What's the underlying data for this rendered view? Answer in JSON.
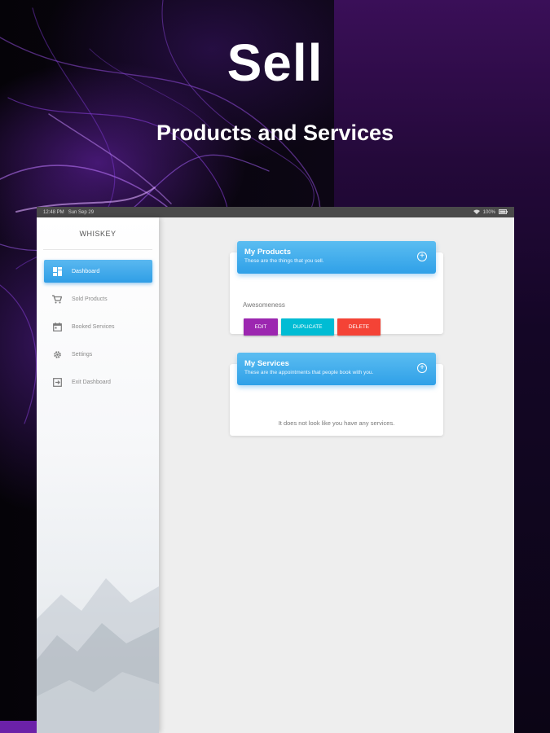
{
  "hero": {
    "title": "Sell",
    "subtitle": "Products and Services"
  },
  "status_bar": {
    "time": "12:48 PM",
    "date": "Sun Sep 29",
    "battery": "100%"
  },
  "sidebar": {
    "brand": "WHISKEY",
    "items": [
      {
        "label": "Dashboard",
        "icon": "dashboard-icon",
        "active": true
      },
      {
        "label": "Sold Products",
        "icon": "cart-icon",
        "active": false
      },
      {
        "label": "Booked Services",
        "icon": "calendar-icon",
        "active": false
      },
      {
        "label": "Settings",
        "icon": "gear-icon",
        "active": false
      },
      {
        "label": "Exit Dashboard",
        "icon": "exit-icon",
        "active": false
      }
    ]
  },
  "products_card": {
    "title": "My Products",
    "description": "These are the things that you sell.",
    "add_icon": "add-circle-icon",
    "items": [
      {
        "name": "Awesomeness",
        "actions": {
          "edit": "EDIT",
          "duplicate": "DUPLICATE",
          "delete": "DELETE"
        }
      }
    ]
  },
  "services_card": {
    "title": "My Services",
    "description": "These are the appointments that people book with you.",
    "add_icon": "add-circle-icon",
    "empty_message": "It does not look like you have any services."
  },
  "colors": {
    "accent_blue": "#2fa0e8",
    "edit": "#9c27b0",
    "duplicate": "#00bcd4",
    "delete": "#f44336",
    "brand_purple": "#6b21a8"
  }
}
